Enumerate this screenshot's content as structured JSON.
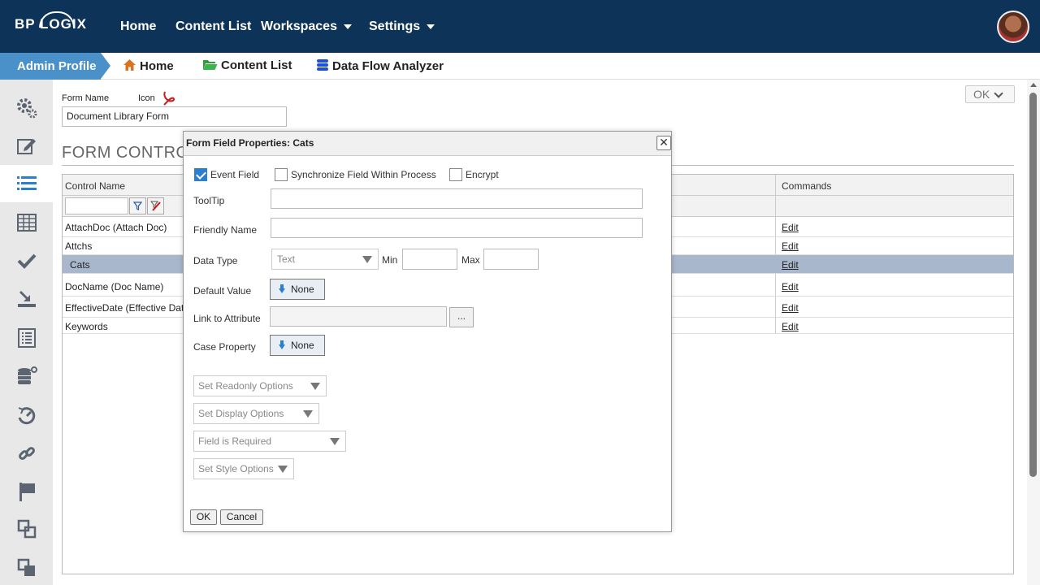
{
  "topnav": {
    "logo": "BP LOGIX",
    "items": [
      {
        "label": "Home"
      },
      {
        "label": "Content List"
      },
      {
        "label": "Workspaces"
      },
      {
        "label": "Settings"
      }
    ]
  },
  "subnav": {
    "profile": "Admin Profile",
    "items": [
      {
        "label": "Home",
        "icon": "home-icon"
      },
      {
        "label": "Content List",
        "icon": "folder-icon"
      },
      {
        "label": "Data Flow Analyzer",
        "icon": "database-icon"
      }
    ]
  },
  "sidebar": {
    "icons": [
      "gear-icon",
      "edit-icon",
      "list-icon",
      "table-icon",
      "check-icon",
      "import-icon",
      "report-icon",
      "database-settings-icon",
      "dashboard-icon",
      "link-icon",
      "flag-icon",
      "copy-icon",
      "copy-outline-icon"
    ],
    "active_index": 2
  },
  "page": {
    "ok_button": "OK",
    "form_name_label": "Form Name",
    "icon_label": "Icon",
    "form_name_value": "Document Library Form",
    "section_title": "FORM CONTRO"
  },
  "grid": {
    "headers": {
      "control_name": "Control Name",
      "commands": "Commands"
    },
    "rows": [
      {
        "name": "AttachDoc (Attach Doc)",
        "command": "Edit"
      },
      {
        "name": "Attchs",
        "command": "Edit"
      },
      {
        "name": "Cats",
        "command": "Edit",
        "selected": true
      },
      {
        "name": "DocName (Doc Name)",
        "command": "Edit"
      },
      {
        "name": "EffectiveDate (Effective Date",
        "command": "Edit"
      },
      {
        "name": "Keywords",
        "command": "Edit"
      }
    ]
  },
  "modal": {
    "title": "Form Field Properties: Cats",
    "close": "✕",
    "event_field": {
      "label": "Event Field",
      "checked": true
    },
    "sync_field": {
      "label": "Synchronize Field Within Process",
      "checked": false
    },
    "encrypt": {
      "label": "Encrypt",
      "checked": false
    },
    "tooltip_label": "ToolTip",
    "tooltip_value": "",
    "friendly_name_label": "Friendly Name",
    "friendly_name_value": "",
    "data_type_label": "Data Type",
    "data_type_value": "Text",
    "min_label": "Min",
    "max_label": "Max",
    "default_value_label": "Default Value",
    "default_value_btn": "None",
    "link_attr_label": "Link to Attribute",
    "link_attr_btn": "...",
    "case_property_label": "Case Property",
    "case_property_btn": "None",
    "options": [
      "Set Readonly Options",
      "Set Display Options",
      "Field is Required",
      "Set Style Options"
    ],
    "ok": "OK",
    "cancel": "Cancel"
  },
  "colors": {
    "topnav": "#0d3458",
    "accent": "#4a90c9",
    "selected_row": "#a9b7cc"
  }
}
